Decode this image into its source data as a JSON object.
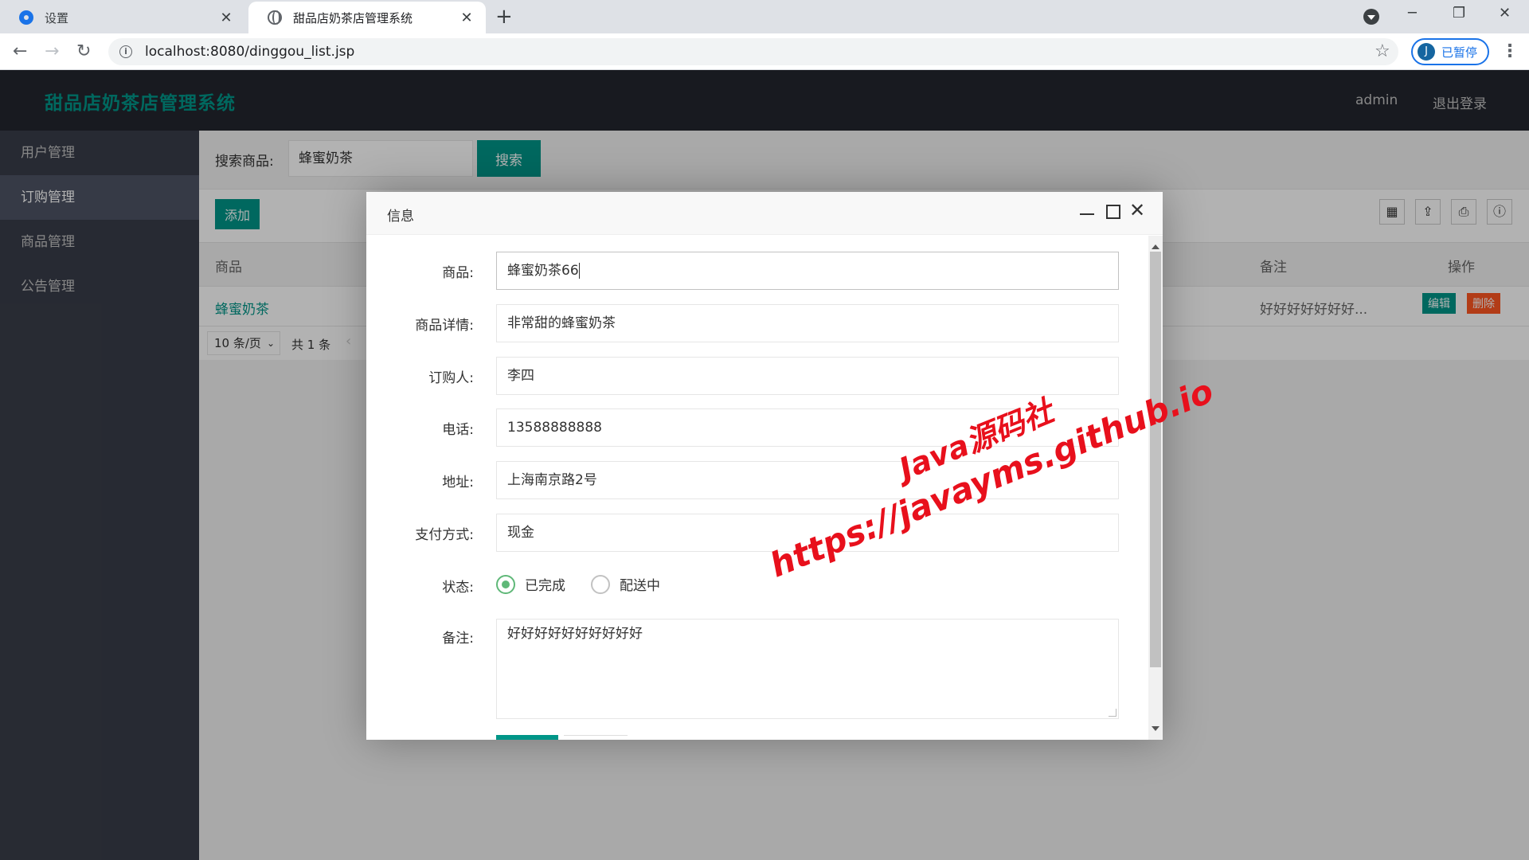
{
  "browser": {
    "tabs": [
      {
        "title": "设置",
        "close": "✕"
      },
      {
        "title": "甜品店奶茶店管理系统",
        "close": "✕"
      }
    ],
    "new_tab": "+",
    "window_controls": {
      "minimize": "─",
      "restore": "❐",
      "close": "✕"
    },
    "url": "localhost:8080/dinggou_list.jsp",
    "profile": {
      "initial": "J",
      "status": "已暂停"
    }
  },
  "app": {
    "title": "甜品店奶茶店管理系统",
    "header": {
      "user": "admin",
      "logout": "退出登录"
    },
    "sidebar": {
      "items": [
        {
          "label": "用户管理"
        },
        {
          "label": "订购管理",
          "active": true
        },
        {
          "label": "商品管理"
        },
        {
          "label": "公告管理"
        }
      ]
    },
    "search": {
      "label": "搜索商品:",
      "value": "蜂蜜奶茶",
      "button": "搜索"
    },
    "toolbar": {
      "add": "添加"
    },
    "table": {
      "headers": {
        "product": "商品",
        "notes": "备注",
        "actions": "操作"
      },
      "rows": [
        {
          "product": "蜂蜜奶茶",
          "notes": "好好好好好好好...",
          "edit": "编辑",
          "delete": "删除"
        }
      ]
    },
    "pagination": {
      "page_size": "10 条/页",
      "total": "共 1 条"
    }
  },
  "modal": {
    "title": "信息",
    "form": {
      "product": {
        "label": "商品:",
        "value": "蜂蜜奶茶66"
      },
      "detail": {
        "label": "商品详情:",
        "value": "非常甜的蜂蜜奶茶"
      },
      "buyer": {
        "label": "订购人:",
        "value": "李四"
      },
      "phone": {
        "label": "电话:",
        "value": "13588888888"
      },
      "address": {
        "label": "地址:",
        "value": "上海南京路2号"
      },
      "payment": {
        "label": "支付方式:",
        "value": "现金"
      },
      "status": {
        "label": "状态:",
        "options": [
          "已完成",
          "配送中"
        ],
        "selected": "已完成"
      },
      "notes": {
        "label": "备注:",
        "value": "好好好好好好好好好好"
      }
    }
  },
  "watermark": {
    "line1": "Java源码社",
    "line2": "https://javayms.github.io"
  },
  "colors": {
    "accent": "#009688",
    "danger": "#ff5722",
    "radio": "#5fb878",
    "watermark": "#e8101c"
  }
}
